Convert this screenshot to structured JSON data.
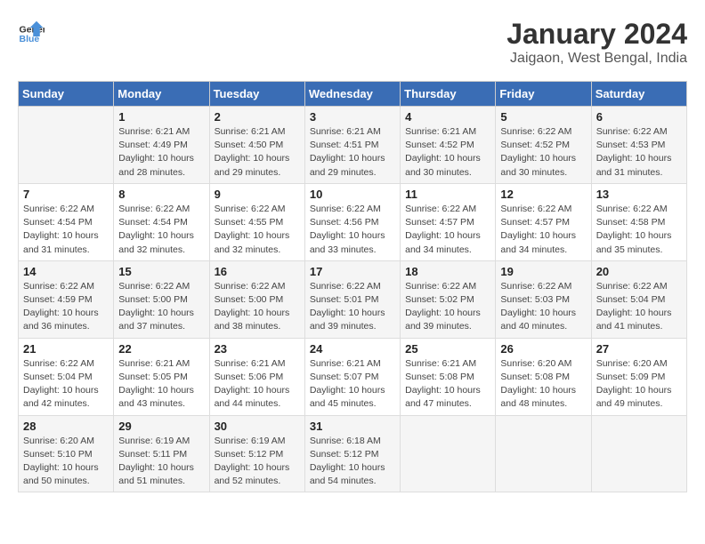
{
  "header": {
    "logo_line1": "General",
    "logo_line2": "Blue",
    "month": "January 2024",
    "location": "Jaigaon, West Bengal, India"
  },
  "weekdays": [
    "Sunday",
    "Monday",
    "Tuesday",
    "Wednesday",
    "Thursday",
    "Friday",
    "Saturday"
  ],
  "weeks": [
    [
      {
        "day": "",
        "sunrise": "",
        "sunset": "",
        "daylight": ""
      },
      {
        "day": "1",
        "sunrise": "Sunrise: 6:21 AM",
        "sunset": "Sunset: 4:49 PM",
        "daylight": "Daylight: 10 hours and 28 minutes."
      },
      {
        "day": "2",
        "sunrise": "Sunrise: 6:21 AM",
        "sunset": "Sunset: 4:50 PM",
        "daylight": "Daylight: 10 hours and 29 minutes."
      },
      {
        "day": "3",
        "sunrise": "Sunrise: 6:21 AM",
        "sunset": "Sunset: 4:51 PM",
        "daylight": "Daylight: 10 hours and 29 minutes."
      },
      {
        "day": "4",
        "sunrise": "Sunrise: 6:21 AM",
        "sunset": "Sunset: 4:52 PM",
        "daylight": "Daylight: 10 hours and 30 minutes."
      },
      {
        "day": "5",
        "sunrise": "Sunrise: 6:22 AM",
        "sunset": "Sunset: 4:52 PM",
        "daylight": "Daylight: 10 hours and 30 minutes."
      },
      {
        "day": "6",
        "sunrise": "Sunrise: 6:22 AM",
        "sunset": "Sunset: 4:53 PM",
        "daylight": "Daylight: 10 hours and 31 minutes."
      }
    ],
    [
      {
        "day": "7",
        "sunrise": "Sunrise: 6:22 AM",
        "sunset": "Sunset: 4:54 PM",
        "daylight": "Daylight: 10 hours and 31 minutes."
      },
      {
        "day": "8",
        "sunrise": "Sunrise: 6:22 AM",
        "sunset": "Sunset: 4:54 PM",
        "daylight": "Daylight: 10 hours and 32 minutes."
      },
      {
        "day": "9",
        "sunrise": "Sunrise: 6:22 AM",
        "sunset": "Sunset: 4:55 PM",
        "daylight": "Daylight: 10 hours and 32 minutes."
      },
      {
        "day": "10",
        "sunrise": "Sunrise: 6:22 AM",
        "sunset": "Sunset: 4:56 PM",
        "daylight": "Daylight: 10 hours and 33 minutes."
      },
      {
        "day": "11",
        "sunrise": "Sunrise: 6:22 AM",
        "sunset": "Sunset: 4:57 PM",
        "daylight": "Daylight: 10 hours and 34 minutes."
      },
      {
        "day": "12",
        "sunrise": "Sunrise: 6:22 AM",
        "sunset": "Sunset: 4:57 PM",
        "daylight": "Daylight: 10 hours and 34 minutes."
      },
      {
        "day": "13",
        "sunrise": "Sunrise: 6:22 AM",
        "sunset": "Sunset: 4:58 PM",
        "daylight": "Daylight: 10 hours and 35 minutes."
      }
    ],
    [
      {
        "day": "14",
        "sunrise": "Sunrise: 6:22 AM",
        "sunset": "Sunset: 4:59 PM",
        "daylight": "Daylight: 10 hours and 36 minutes."
      },
      {
        "day": "15",
        "sunrise": "Sunrise: 6:22 AM",
        "sunset": "Sunset: 5:00 PM",
        "daylight": "Daylight: 10 hours and 37 minutes."
      },
      {
        "day": "16",
        "sunrise": "Sunrise: 6:22 AM",
        "sunset": "Sunset: 5:00 PM",
        "daylight": "Daylight: 10 hours and 38 minutes."
      },
      {
        "day": "17",
        "sunrise": "Sunrise: 6:22 AM",
        "sunset": "Sunset: 5:01 PM",
        "daylight": "Daylight: 10 hours and 39 minutes."
      },
      {
        "day": "18",
        "sunrise": "Sunrise: 6:22 AM",
        "sunset": "Sunset: 5:02 PM",
        "daylight": "Daylight: 10 hours and 39 minutes."
      },
      {
        "day": "19",
        "sunrise": "Sunrise: 6:22 AM",
        "sunset": "Sunset: 5:03 PM",
        "daylight": "Daylight: 10 hours and 40 minutes."
      },
      {
        "day": "20",
        "sunrise": "Sunrise: 6:22 AM",
        "sunset": "Sunset: 5:04 PM",
        "daylight": "Daylight: 10 hours and 41 minutes."
      }
    ],
    [
      {
        "day": "21",
        "sunrise": "Sunrise: 6:22 AM",
        "sunset": "Sunset: 5:04 PM",
        "daylight": "Daylight: 10 hours and 42 minutes."
      },
      {
        "day": "22",
        "sunrise": "Sunrise: 6:21 AM",
        "sunset": "Sunset: 5:05 PM",
        "daylight": "Daylight: 10 hours and 43 minutes."
      },
      {
        "day": "23",
        "sunrise": "Sunrise: 6:21 AM",
        "sunset": "Sunset: 5:06 PM",
        "daylight": "Daylight: 10 hours and 44 minutes."
      },
      {
        "day": "24",
        "sunrise": "Sunrise: 6:21 AM",
        "sunset": "Sunset: 5:07 PM",
        "daylight": "Daylight: 10 hours and 45 minutes."
      },
      {
        "day": "25",
        "sunrise": "Sunrise: 6:21 AM",
        "sunset": "Sunset: 5:08 PM",
        "daylight": "Daylight: 10 hours and 47 minutes."
      },
      {
        "day": "26",
        "sunrise": "Sunrise: 6:20 AM",
        "sunset": "Sunset: 5:08 PM",
        "daylight": "Daylight: 10 hours and 48 minutes."
      },
      {
        "day": "27",
        "sunrise": "Sunrise: 6:20 AM",
        "sunset": "Sunset: 5:09 PM",
        "daylight": "Daylight: 10 hours and 49 minutes."
      }
    ],
    [
      {
        "day": "28",
        "sunrise": "Sunrise: 6:20 AM",
        "sunset": "Sunset: 5:10 PM",
        "daylight": "Daylight: 10 hours and 50 minutes."
      },
      {
        "day": "29",
        "sunrise": "Sunrise: 6:19 AM",
        "sunset": "Sunset: 5:11 PM",
        "daylight": "Daylight: 10 hours and 51 minutes."
      },
      {
        "day": "30",
        "sunrise": "Sunrise: 6:19 AM",
        "sunset": "Sunset: 5:12 PM",
        "daylight": "Daylight: 10 hours and 52 minutes."
      },
      {
        "day": "31",
        "sunrise": "Sunrise: 6:18 AM",
        "sunset": "Sunset: 5:12 PM",
        "daylight": "Daylight: 10 hours and 54 minutes."
      },
      {
        "day": "",
        "sunrise": "",
        "sunset": "",
        "daylight": ""
      },
      {
        "day": "",
        "sunrise": "",
        "sunset": "",
        "daylight": ""
      },
      {
        "day": "",
        "sunrise": "",
        "sunset": "",
        "daylight": ""
      }
    ]
  ]
}
